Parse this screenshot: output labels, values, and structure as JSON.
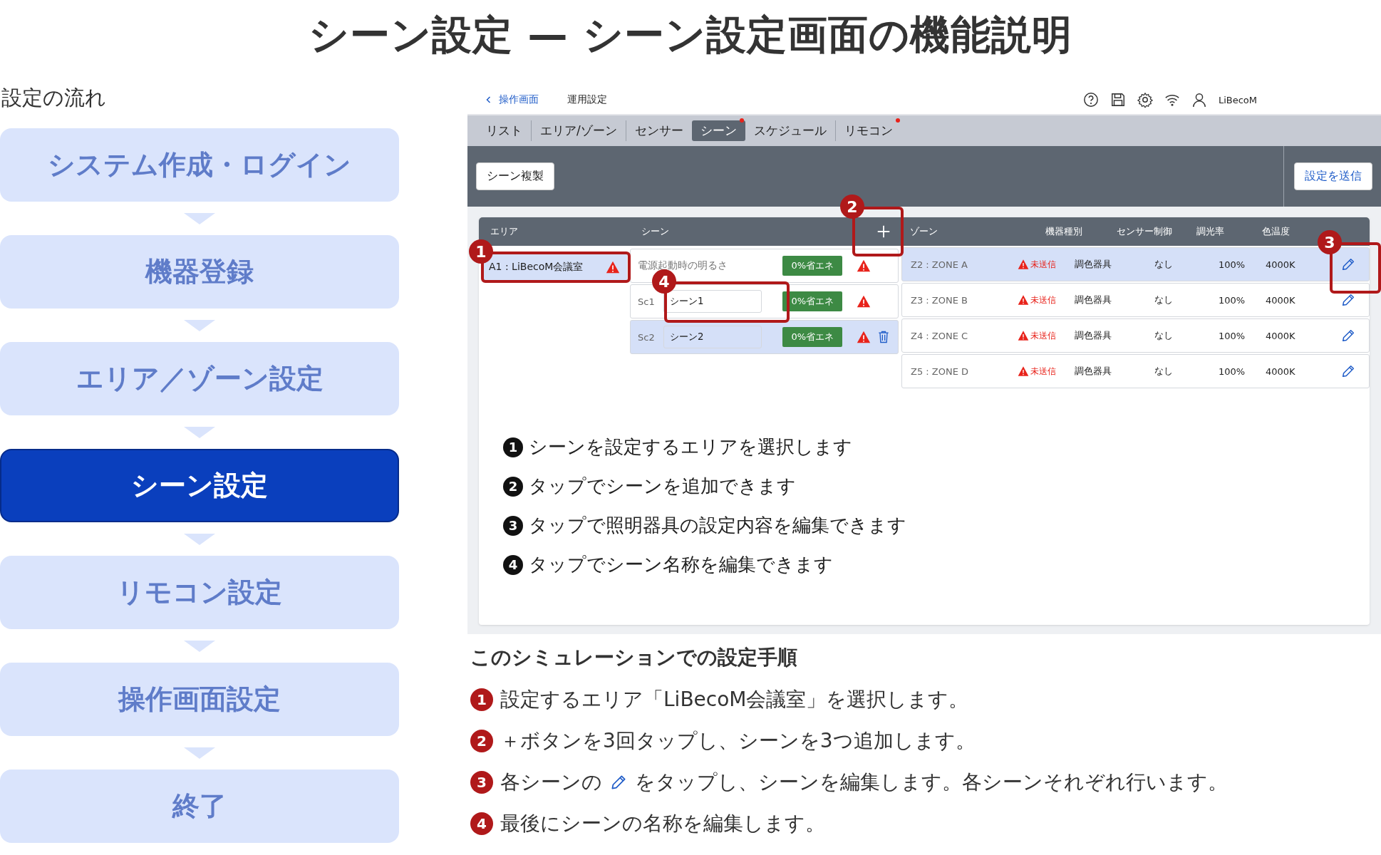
{
  "title": "シーン設定 — シーン設定画面の機能説明",
  "flow": {
    "heading": "設定の流れ",
    "steps": [
      {
        "label": "システム作成・ログイン",
        "selected": false
      },
      {
        "label": "機器登録",
        "selected": false
      },
      {
        "label": "エリア／ゾーン設定",
        "selected": false
      },
      {
        "label": "シーン設定",
        "selected": true
      },
      {
        "label": "リモコン設定",
        "selected": false
      },
      {
        "label": "操作画面設定",
        "selected": false
      },
      {
        "label": "終了",
        "selected": false
      }
    ]
  },
  "app": {
    "back_link": "操作画面",
    "page_title": "運用設定",
    "user": "LiBecoM",
    "tabs": [
      {
        "label": "リスト",
        "selected": false,
        "badge": false
      },
      {
        "label": "エリア/ゾーン",
        "selected": false,
        "badge": false
      },
      {
        "label": "センサー",
        "selected": false,
        "badge": false
      },
      {
        "label": "シーン",
        "selected": true,
        "badge": true
      },
      {
        "label": "スケジュール",
        "selected": false,
        "badge": false
      },
      {
        "label": "リモコン",
        "selected": false,
        "badge": true
      }
    ],
    "copy_button": "シーン複製",
    "send_button": "設定を送信",
    "columns": {
      "area": "エリア",
      "scene": "シーン",
      "zone": "ゾーン",
      "type": "機器種別",
      "sensor": "センサー制御",
      "dimming": "調光率",
      "color_temp": "色温度"
    },
    "areas": [
      {
        "label": "A1 : LiBecoM会議室",
        "selected": true,
        "warning": true
      }
    ],
    "scenes": [
      {
        "kind": "default",
        "name": "電源起動時の明るさ",
        "badge": "0%省エネ",
        "warning": true,
        "selected": false,
        "trash": false
      },
      {
        "kind": "editable",
        "id": "Sc1",
        "name": "シーン1",
        "badge": "0%省エネ",
        "warning": true,
        "selected": false,
        "trash": false
      },
      {
        "kind": "editable",
        "id": "Sc2",
        "name": "シーン2",
        "badge": "0%省エネ",
        "warning": true,
        "selected": true,
        "trash": true
      }
    ],
    "zones": [
      {
        "zone": "Z2 : ZONE A",
        "status": "未送信",
        "type": "調色器具",
        "sensor": "なし",
        "dimming": "100%",
        "color_temp": "4000K",
        "selected": true
      },
      {
        "zone": "Z3 : ZONE B",
        "status": "未送信",
        "type": "調色器具",
        "sensor": "なし",
        "dimming": "100%",
        "color_temp": "4000K",
        "selected": false
      },
      {
        "zone": "Z4 : ZONE C",
        "status": "未送信",
        "type": "調色器具",
        "sensor": "なし",
        "dimming": "100%",
        "color_temp": "4000K",
        "selected": false
      },
      {
        "zone": "Z5 : ZONE D",
        "status": "未送信",
        "type": "調色器具",
        "sensor": "なし",
        "dimming": "100%",
        "color_temp": "4000K",
        "selected": false
      }
    ],
    "callouts": [
      {
        "number": "1"
      },
      {
        "number": "2"
      },
      {
        "number": "3"
      },
      {
        "number": "4"
      }
    ],
    "notes": [
      {
        "number": "1",
        "text": "シーンを設定するエリアを選択します"
      },
      {
        "number": "2",
        "text": "タップでシーンを追加できます"
      },
      {
        "number": "3",
        "text": "タップで照明器具の設定内容を編集できます"
      },
      {
        "number": "4",
        "text": "タップでシーン名称を編集できます"
      }
    ]
  },
  "procedure": {
    "heading": "このシミュレーションでの設定手順",
    "steps": [
      {
        "number": "1",
        "text": "設定するエリア「LiBecoM会議室」を選択します。"
      },
      {
        "number": "2",
        "text": "＋ボタンを3回タップし、シーンを3つ追加します。"
      },
      {
        "number": "3",
        "text": "各シーンの",
        "text_after": "をタップし、シーンを編集します。各シーンそれぞれ行います。"
      },
      {
        "number": "4",
        "text": "最後にシーンの名称を編集します。"
      }
    ]
  }
}
